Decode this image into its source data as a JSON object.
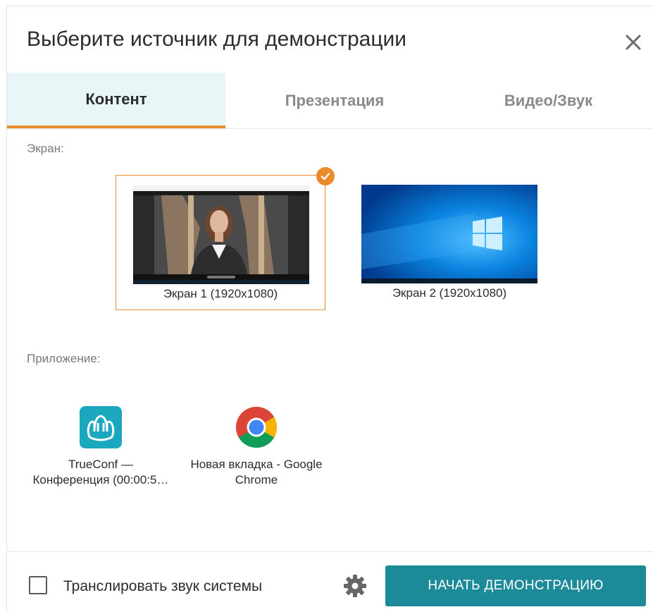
{
  "dialog": {
    "title": "Выберите источник для демонстрации"
  },
  "tabs": [
    {
      "label": "Контент",
      "active": true
    },
    {
      "label": "Презентация",
      "active": false
    },
    {
      "label": "Видео/Звук",
      "active": false
    }
  ],
  "screens_section": {
    "label": "Экран:",
    "items": [
      {
        "caption": "Экран 1 (1920x1080)",
        "selected": true
      },
      {
        "caption": "Экран 2 (1920x1080)",
        "selected": false
      }
    ]
  },
  "apps_section": {
    "label": "Приложение:",
    "items": [
      {
        "label_line1": "TrueConf —",
        "label_line2": "Конференция (00:00:5…",
        "icon": "trueconf-icon"
      },
      {
        "label_line1": "Новая вкладка - Google",
        "label_line2": "Chrome",
        "icon": "chrome-icon"
      }
    ]
  },
  "footer": {
    "system_audio_label": "Транслировать звук системы",
    "system_audio_checked": false,
    "start_button": "НАЧАТЬ ДЕМОНСТРАЦИЮ"
  },
  "colors": {
    "accent_orange": "#e98b2a",
    "primary_teal": "#1c8a99",
    "active_tab_bg": "#e9f6f8"
  }
}
